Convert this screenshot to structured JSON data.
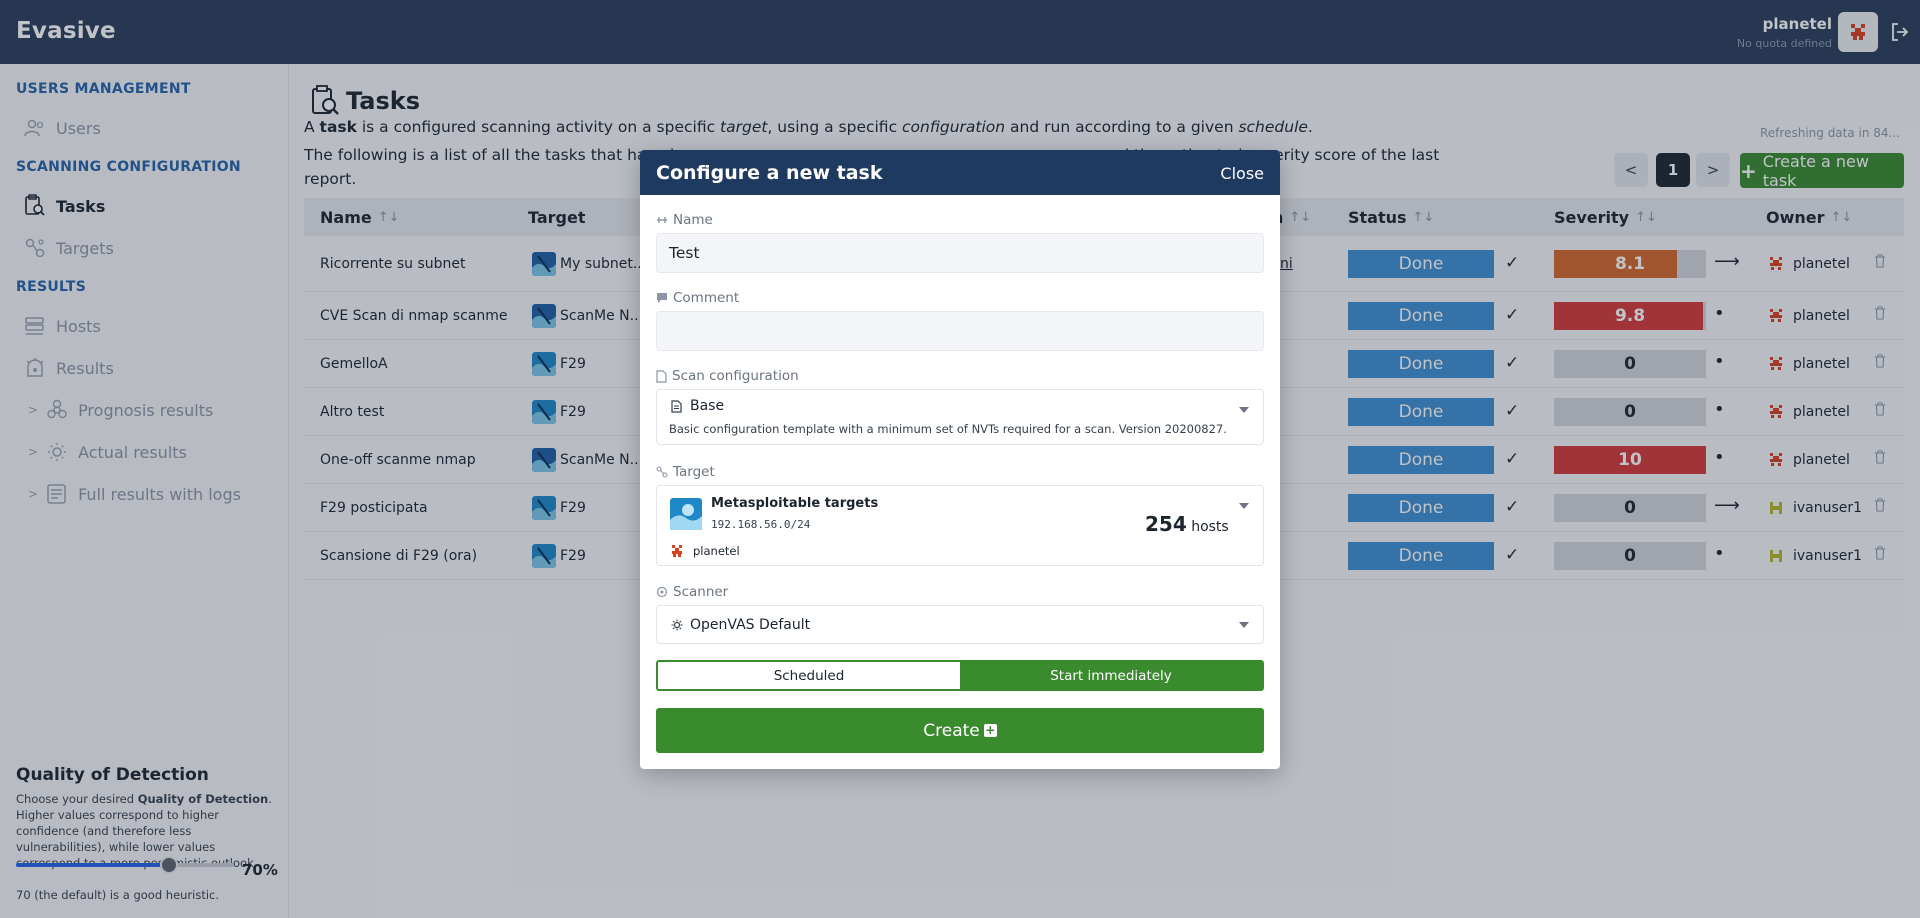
{
  "app": {
    "title": "Evasive"
  },
  "user": {
    "name": "planetel",
    "quota": "No quota defined"
  },
  "sidebar": {
    "sections": [
      {
        "title": "USERS MANAGEMENT",
        "items": [
          {
            "label": "Users"
          }
        ]
      },
      {
        "title": "SCANNING CONFIGURATION",
        "items": [
          {
            "label": "Tasks"
          },
          {
            "label": "Targets"
          }
        ]
      },
      {
        "title": "RESULTS",
        "items": [
          {
            "label": "Hosts"
          },
          {
            "label": "Results"
          },
          {
            "label": "Prognosis results"
          },
          {
            "label": "Actual results"
          },
          {
            "label": "Full results with logs"
          }
        ]
      }
    ],
    "qod": {
      "title": "Quality of Detection",
      "desc_pre": "Choose your desired ",
      "desc_bold": "Quality of Detection",
      "desc_post": ". Higher values correspond to higher confidence (and therefore less vulnerabilities), while lower values correspond to a more pessimistic outlook.",
      "value": 70,
      "value_label": "70%",
      "hint": "70 (the default) is a good heuristic."
    }
  },
  "main": {
    "title": "Tasks",
    "intro": {
      "p1": "A ",
      "b1": "task",
      "p2": " is a configured scanning activity on a specific ",
      "i1": "target",
      "p3": ", using a specific ",
      "i2": "configuration",
      "p4": " and run according to a given ",
      "i3": "schedule",
      "p5": ".",
      "line2_left": "The following is a list of all the tasks that have be",
      "line2_right": "nd the estimated severity score of the last",
      "line3": "report."
    },
    "refresh": "Refreshing data in 84...",
    "pagination": {
      "prev": "<",
      "current": "1",
      "next": ">"
    },
    "create_label": "Create a new task",
    "columns": {
      "name": "Name",
      "target": "Target",
      "schedule_tail": "n",
      "status": "Status",
      "severity": "Severity",
      "owner": "Owner",
      "sort": "↑↓"
    },
    "rows": [
      {
        "name": "Ricorrente su subnet",
        "target": "My subnet...",
        "schedule_tail": "ni",
        "status": "Done",
        "severity": "8.1",
        "severity_value": 8.1,
        "severity_color": "#d4672a",
        "trend": "⟶",
        "owner": "planetel"
      },
      {
        "name": "CVE Scan di nmap scanme",
        "target": "ScanMe N...",
        "schedule_tail": "",
        "status": "Done",
        "severity": "9.8",
        "severity_value": 9.8,
        "severity_color": "#d43a3a",
        "trend": "•",
        "owner": "planetel"
      },
      {
        "name": "GemelloA",
        "target": "F29",
        "schedule_tail": "",
        "status": "Done",
        "severity": "0",
        "severity_value": 0,
        "severity_color": "#d2d5da",
        "trend": "•",
        "owner": "planetel"
      },
      {
        "name": "Altro test",
        "target": "F29",
        "schedule_tail": "",
        "status": "Done",
        "severity": "0",
        "severity_value": 0,
        "severity_color": "#d2d5da",
        "trend": "•",
        "owner": "planetel"
      },
      {
        "name": "One-off scanme nmap",
        "target": "ScanMe N...",
        "schedule_tail": "",
        "status": "Done",
        "severity": "10",
        "severity_value": 10,
        "severity_color": "#d43a3a",
        "trend": "•",
        "owner": "planetel"
      },
      {
        "name": "F29 posticipata",
        "target": "F29",
        "schedule_tail": "",
        "status": "Done",
        "severity": "0",
        "severity_value": 0,
        "severity_color": "#d2d5da",
        "trend": "⟶",
        "owner": "ivanuser1"
      },
      {
        "name": "Scansione di F29 (ora)",
        "target": "F29",
        "schedule_tail": "",
        "status": "Done",
        "severity": "0",
        "severity_value": 0,
        "severity_color": "#d2d5da",
        "trend": "•",
        "owner": "ivanuser1"
      }
    ]
  },
  "modal": {
    "title": "Configure a new task",
    "close": "Close",
    "name_label": "Name",
    "name_value": "Test",
    "comment_label": "Comment",
    "comment_value": "",
    "scan_config_label": "Scan configuration",
    "scan_config_value": "Base",
    "scan_config_desc": "Basic configuration template with a minimum set of NVTs required for a scan. Version 20200827.",
    "target_label": "Target",
    "target_name": "Metasploitable targets",
    "target_ip": "192.168.56.0/24",
    "target_hosts_count": "254",
    "target_hosts_label": "hosts",
    "target_owner": "planetel",
    "scanner_label": "Scanner",
    "scanner_value": "OpenVAS Default",
    "mode_scheduled": "Scheduled",
    "mode_immediate": "Start immediately",
    "create_label": "Create"
  },
  "colors": {
    "topbar": "#2c3e5c",
    "accent_green": "#3a8a2e",
    "status_blue": "#3f8fd2",
    "section_blue": "#2563a8"
  }
}
